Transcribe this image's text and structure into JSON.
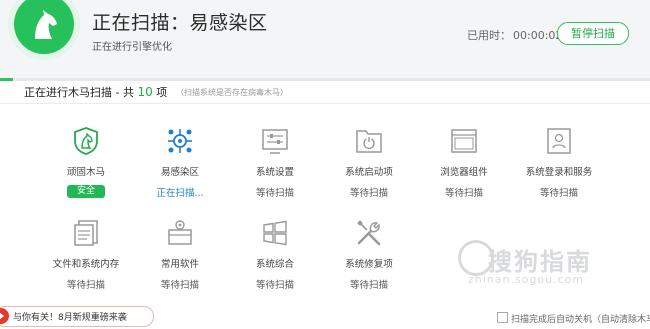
{
  "header": {
    "title": "正在扫描：易感染区",
    "subtitle": "正在进行引擎优化",
    "elapsed_label": "已用时：",
    "elapsed_value": "00:00:02",
    "pause_label": "暂停扫描",
    "progress_percent": 2
  },
  "scan": {
    "heading_prefix": "正在进行木马扫描 - 共 ",
    "count": "10",
    "heading_suffix": " 项",
    "note": "（扫描系统是否存在病毒木马）"
  },
  "items": [
    {
      "label": "顽固木马",
      "status": "安全",
      "icon": "shield-horse-icon"
    },
    {
      "label": "易感染区",
      "status": "正在扫描...",
      "icon": "virus-hotspot-icon"
    },
    {
      "label": "系统设置",
      "status": "等待扫描",
      "icon": "settings-sliders-icon"
    },
    {
      "label": "系统启动项",
      "status": "等待扫描",
      "icon": "startup-folder-icon"
    },
    {
      "label": "浏览器组件",
      "status": "等待扫描",
      "icon": "browser-window-icon"
    },
    {
      "label": "系统登录和服务",
      "status": "等待扫描",
      "icon": "login-user-icon"
    },
    {
      "label": "文件和系统内存",
      "status": "等待扫描",
      "icon": "file-memory-icon"
    },
    {
      "label": "常用软件",
      "status": "等待扫描",
      "icon": "software-box-icon"
    },
    {
      "label": "系统综合",
      "status": "等待扫描",
      "icon": "windows-logo-icon"
    },
    {
      "label": "系统修复项",
      "status": "等待扫描",
      "icon": "repair-tools-icon"
    }
  ],
  "footer": {
    "news_text": "与你有关！8月新规重磅来袭",
    "autooff_text": "扫描完成后自动关机（自动清除木马"
  },
  "watermark": {
    "cn": "搜狗指南",
    "en": "zhinan.sogou.com"
  },
  "colors": {
    "accent": "#26c15a",
    "scanning": "#1d7ed6",
    "safe_badge": "#23b856"
  }
}
